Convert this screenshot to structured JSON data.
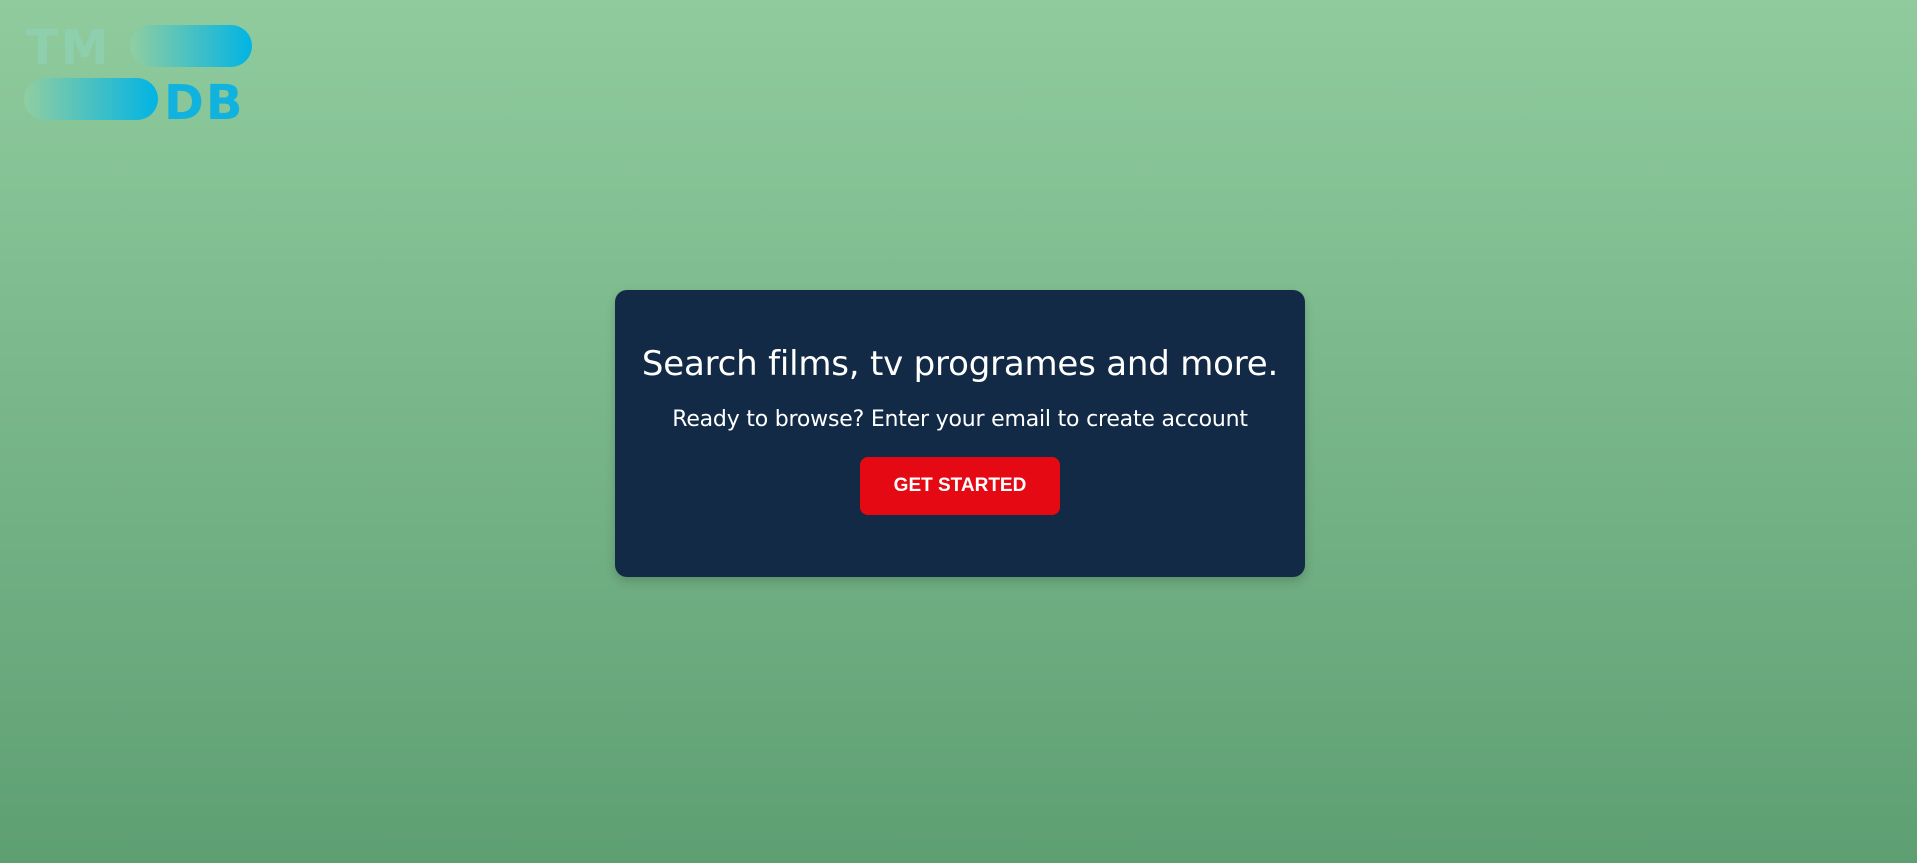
{
  "logo": {
    "text_top": "TM",
    "text_bottom": "DB",
    "color_start": "#90cea1",
    "color_end": "#01b4e4"
  },
  "hero": {
    "heading": "Search films, tv programes and more.",
    "subheading": "Ready to browse? Enter your email to create account",
    "cta_label": "GET STARTED"
  },
  "colors": {
    "card_background": "#122a45",
    "cta_background": "#e50914",
    "page_gradient_top": "#8fcb9d",
    "page_gradient_bottom": "#5e9f72"
  }
}
